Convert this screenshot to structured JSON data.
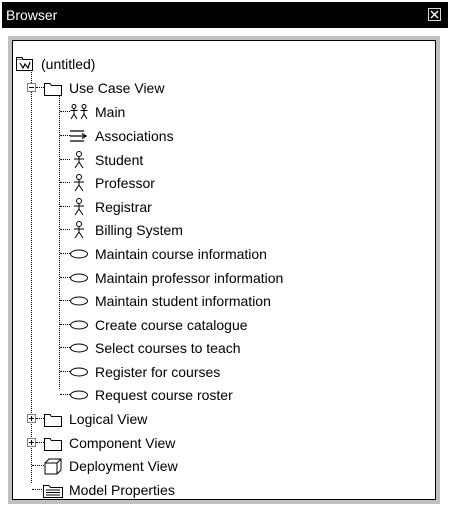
{
  "window": {
    "title": "Browser"
  },
  "tree": {
    "root": {
      "label": "(untitled)",
      "icon": "package-icon"
    },
    "use_case_view": {
      "label": "Use Case View",
      "expanded": true,
      "children": [
        {
          "label": "Main",
          "icon": "use-case-diagram-icon"
        },
        {
          "label": "Associations",
          "icon": "associations-icon"
        },
        {
          "label": "Student",
          "icon": "actor-icon"
        },
        {
          "label": "Professor",
          "icon": "actor-icon"
        },
        {
          "label": "Registrar",
          "icon": "actor-icon"
        },
        {
          "label": "Billing System",
          "icon": "actor-icon"
        },
        {
          "label": "Maintain course information",
          "icon": "use-case-icon"
        },
        {
          "label": "Maintain professor information",
          "icon": "use-case-icon"
        },
        {
          "label": "Maintain student information",
          "icon": "use-case-icon"
        },
        {
          "label": "Create course catalogue",
          "icon": "use-case-icon"
        },
        {
          "label": "Select courses to teach",
          "icon": "use-case-icon"
        },
        {
          "label": "Register for courses",
          "icon": "use-case-icon"
        },
        {
          "label": "Request course roster",
          "icon": "use-case-icon"
        }
      ]
    },
    "logical_view": {
      "label": "Logical View",
      "expanded": false
    },
    "component_view": {
      "label": "Component View",
      "expanded": false
    },
    "deployment_view": {
      "label": "Deployment View"
    },
    "model_properties": {
      "label": "Model Properties"
    }
  }
}
